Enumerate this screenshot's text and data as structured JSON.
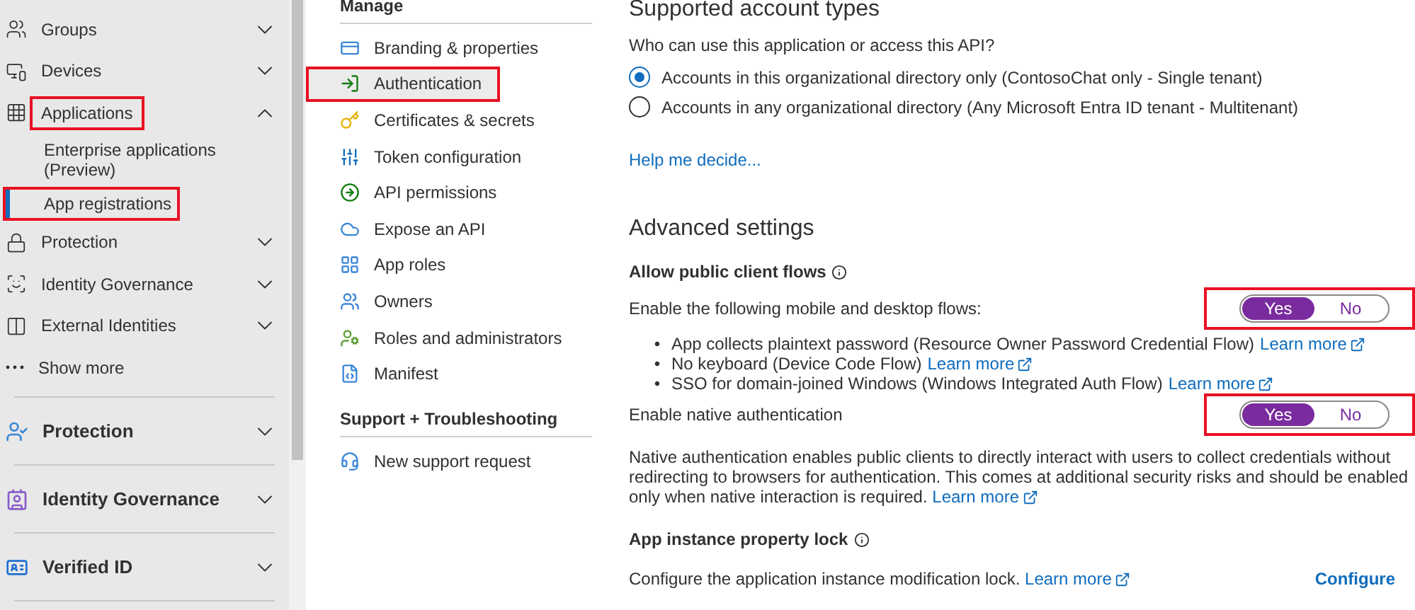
{
  "nav": {
    "items": [
      {
        "label": "Groups",
        "expanded": false,
        "highlighted": false
      },
      {
        "label": "Devices",
        "expanded": false,
        "highlighted": false
      },
      {
        "label": "Applications",
        "expanded": true,
        "highlighted": true,
        "children": [
          {
            "label": "Enterprise applications (Preview)",
            "selected": false,
            "highlighted": false
          },
          {
            "label": "App registrations",
            "selected": true,
            "highlighted": true
          }
        ]
      },
      {
        "label": "Protection",
        "expanded": false,
        "highlighted": false
      },
      {
        "label": "Identity Governance",
        "expanded": false,
        "highlighted": false
      },
      {
        "label": "External Identities",
        "expanded": false,
        "highlighted": false
      },
      {
        "label": "Show more",
        "kind": "more"
      }
    ],
    "sections": [
      {
        "label": "Protection",
        "expanded": false
      },
      {
        "label": "Identity Governance",
        "expanded": false
      },
      {
        "label": "Verified ID",
        "expanded": false
      }
    ]
  },
  "menu": {
    "sections": [
      {
        "title": "Manage",
        "items": [
          {
            "label": "Branding & properties",
            "selected": false,
            "highlighted": false
          },
          {
            "label": "Authentication",
            "selected": true,
            "highlighted": true
          },
          {
            "label": "Certificates & secrets",
            "selected": false,
            "highlighted": false
          },
          {
            "label": "Token configuration",
            "selected": false,
            "highlighted": false
          },
          {
            "label": "API permissions",
            "selected": false,
            "highlighted": false
          },
          {
            "label": "Expose an API",
            "selected": false,
            "highlighted": false
          },
          {
            "label": "App roles",
            "selected": false,
            "highlighted": false
          },
          {
            "label": "Owners",
            "selected": false,
            "highlighted": false
          },
          {
            "label": "Roles and administrators",
            "selected": false,
            "highlighted": false
          },
          {
            "label": "Manifest",
            "selected": false,
            "highlighted": false
          }
        ]
      },
      {
        "title": "Support + Troubleshooting",
        "items": [
          {
            "label": "New support request",
            "selected": false,
            "highlighted": false
          }
        ]
      }
    ]
  },
  "content": {
    "heading": "Supported account types",
    "question": "Who can use this application or access this API?",
    "account_types": [
      {
        "label": "Accounts in this organizational directory only (ContosoChat only - Single tenant)",
        "selected": true
      },
      {
        "label": "Accounts in any organizational directory (Any Microsoft Entra ID tenant - Multitenant)",
        "selected": false
      }
    ],
    "help_link": "Help me decide...",
    "advanced_heading": "Advanced settings",
    "public_client": {
      "title": "Allow public client flows",
      "label": "Enable the following mobile and desktop flows:",
      "toggle": {
        "highlighted": true,
        "options": [
          {
            "label": "Yes",
            "selected": true
          },
          {
            "label": "No",
            "selected": false
          }
        ]
      },
      "flows": [
        {
          "marker": "•",
          "text": "App collects plaintext password (Resource Owner Password Credential Flow)",
          "link": "Learn more"
        },
        {
          "marker": "•",
          "text": "No keyboard (Device Code Flow)",
          "link": "Learn more"
        },
        {
          "marker": "•",
          "text": "SSO for domain-joined Windows (Windows Integrated Auth Flow)",
          "link": "Learn more"
        }
      ]
    },
    "native_auth": {
      "label": "Enable native authentication",
      "toggle": {
        "highlighted": true,
        "options": [
          {
            "label": "Yes",
            "selected": true
          },
          {
            "label": "No",
            "selected": false
          }
        ]
      },
      "description": "Native authentication enables public clients to directly interact with users to collect credentials without redirecting to browsers for authentication. This comes at additional security risks and should be enabled only when native interaction is required.",
      "link": "Learn more"
    },
    "property_lock": {
      "title": "App instance property lock",
      "description": "Configure the application instance modification lock.",
      "link": "Learn more",
      "action": "Configure"
    }
  }
}
